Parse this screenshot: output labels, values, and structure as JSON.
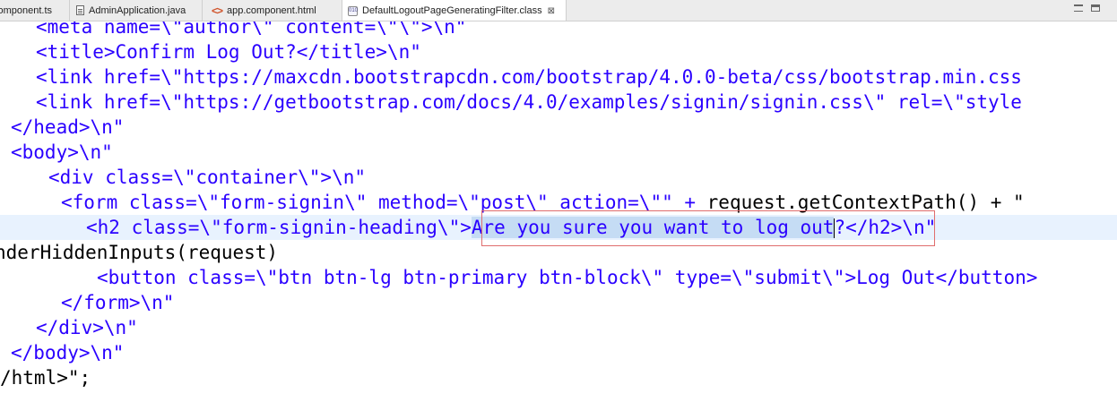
{
  "tabs": [
    {
      "label": "component.ts",
      "icon": "typescript-file-icon",
      "active": false
    },
    {
      "label": "AdminApplication.java",
      "icon": "java-file-icon",
      "active": false
    },
    {
      "label": "app.component.html",
      "icon": "html-file-icon",
      "active": false
    },
    {
      "label": "DefaultLogoutPageGeneratingFilter.class",
      "icon": "class-file-icon",
      "active": true
    }
  ],
  "close_symbol": "⊠",
  "html_icon_glyph": "<>",
  "class_icon_glyph": "010",
  "window_controls": [
    "minimize-icon",
    "maximize-icon"
  ],
  "code_lines": [
    "<meta name=\\\"author\\\" content=\\\"\\\">\\n\"",
    "<title>Confirm Log Out?</title>\\n\"",
    "<link href=\\\"https://maxcdn.bootstrapcdn.com/bootstrap/4.0.0-beta/css/bootstrap.min.css",
    "<link href=\\\"https://getbootstrap.com/docs/4.0/examples/signin/signin.css\\\" rel=\\\"style",
    "</head>\\n\"",
    "<body>\\n\"",
    "<div class=\\\"container\\\">\\n\"",
    "<form class=\\\"form-signin\\\" method=\\\"post\\\" action=\\\"\" + ",
    "request.getContextPath() + \"",
    "<h2 class=\\\"form-signin-heading\\\">",
    "Are you sure you want to log out",
    "?</h2>\\n\"",
    "nderHiddenInputs(request)",
    "<button class=\\\"btn btn-lg btn-primary btn-block\\\" type=\\\"submit\\\">Log Out</button>",
    "</form>\\n\"",
    "</div>\\n\"",
    "</body>\\n\"",
    "/html>\";"
  ],
  "colors": {
    "string": "#2a00ff",
    "code": "#000000",
    "selection": "#c5dcf4",
    "current_line": "#e8f2fe",
    "annotation_box": "#e06d6d"
  }
}
